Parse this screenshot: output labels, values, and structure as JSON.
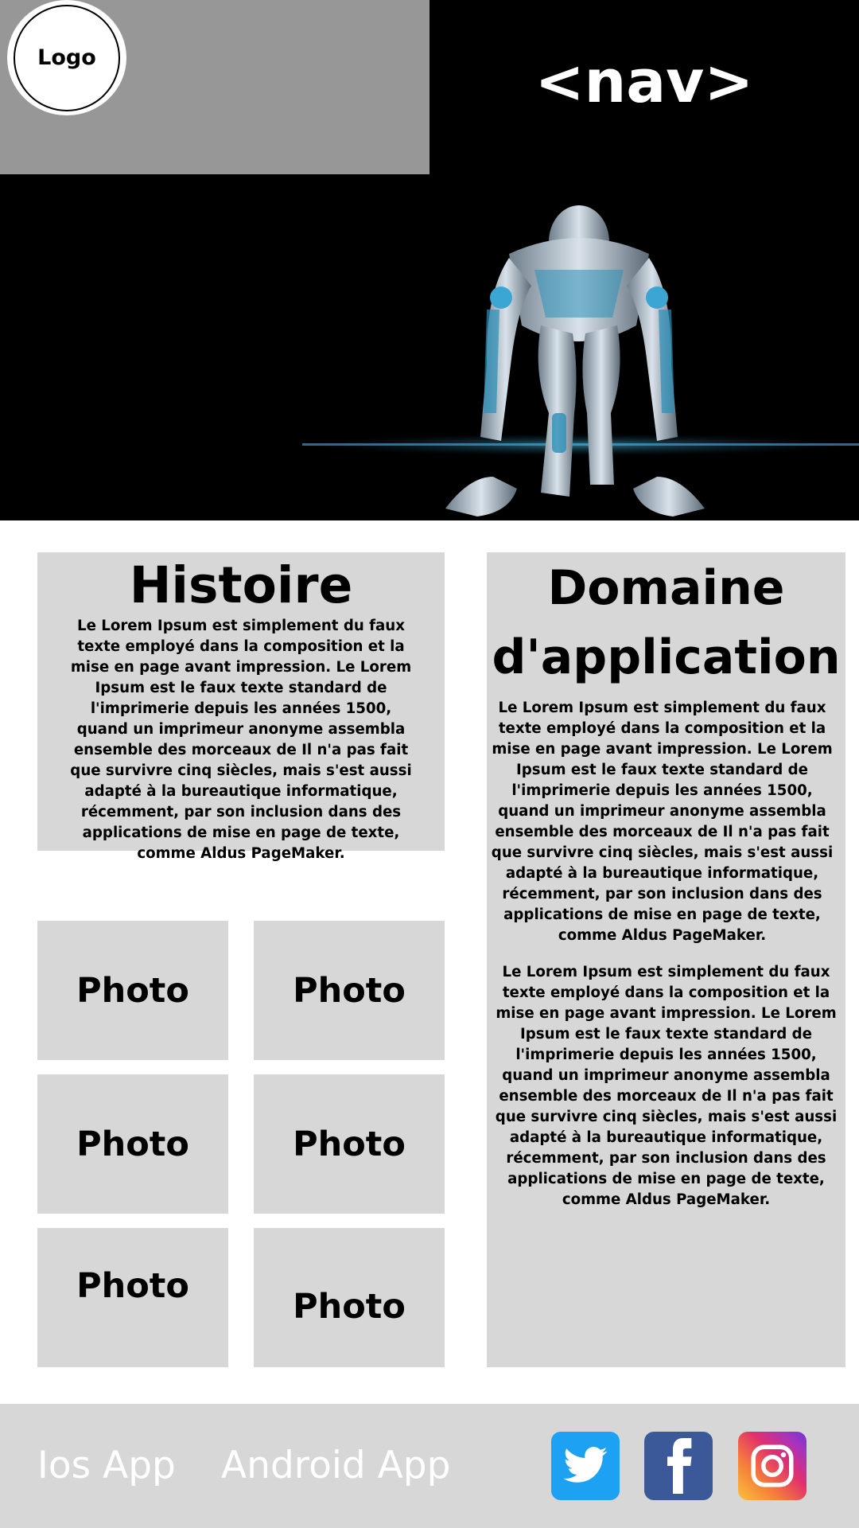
{
  "header": {
    "logo_label": "Logo",
    "nav_label": "<nav>"
  },
  "histoire": {
    "title": "Histoire",
    "text": "Le Lorem Ipsum est simplement du faux texte employé dans la composition et la mise en page avant impression. Le Lorem Ipsum est le faux texte standard de l'imprimerie depuis les années 1500, quand un imprimeur anonyme assembla ensemble des morceaux de Il n'a pas fait que survivre cinq siècles, mais s'est aussi adapté à la bureautique informatique, récemment, par son inclusion dans des applications de mise en page de texte, comme Aldus PageMaker."
  },
  "domaine": {
    "title_line1": "Domaine",
    "title_line2": "d'application",
    "paragraph1": "Le Lorem Ipsum est simplement du faux texte employé dans la composition et la mise en page avant impression. Le Lorem Ipsum est le faux texte standard de l'imprimerie depuis les années 1500, quand un imprimeur anonyme assembla ensemble des morceaux de Il n'a pas fait que survivre cinq siècles, mais s'est aussi adapté à la bureautique informatique, récemment, par son inclusion dans des applications de mise en page de texte, comme Aldus PageMaker.",
    "paragraph2": "Le Lorem Ipsum est simplement du faux texte employé dans la composition et la mise en page avant impression. Le Lorem Ipsum est le faux texte standard de l'imprimerie depuis les années 1500, quand un imprimeur anonyme assembla ensemble des morceaux de Il n'a pas fait que survivre cinq siècles, mais s'est aussi adapté à la bureautique informatique, récemment, par son inclusion dans des applications de mise en page de texte, comme Aldus PageMaker."
  },
  "photos": [
    "Photo",
    "Photo",
    "Photo",
    "Photo",
    "Photo",
    "Photo"
  ],
  "footer": {
    "ios_label": "Ios App",
    "android_label": "Android App",
    "social_icons": [
      "twitter-icon",
      "facebook-icon",
      "instagram-icon"
    ]
  },
  "colors": {
    "panel_gray": "#d7d7d7",
    "header_gray": "#979797",
    "twitter_blue": "#1da1f2",
    "facebook_blue": "#3b5998"
  }
}
